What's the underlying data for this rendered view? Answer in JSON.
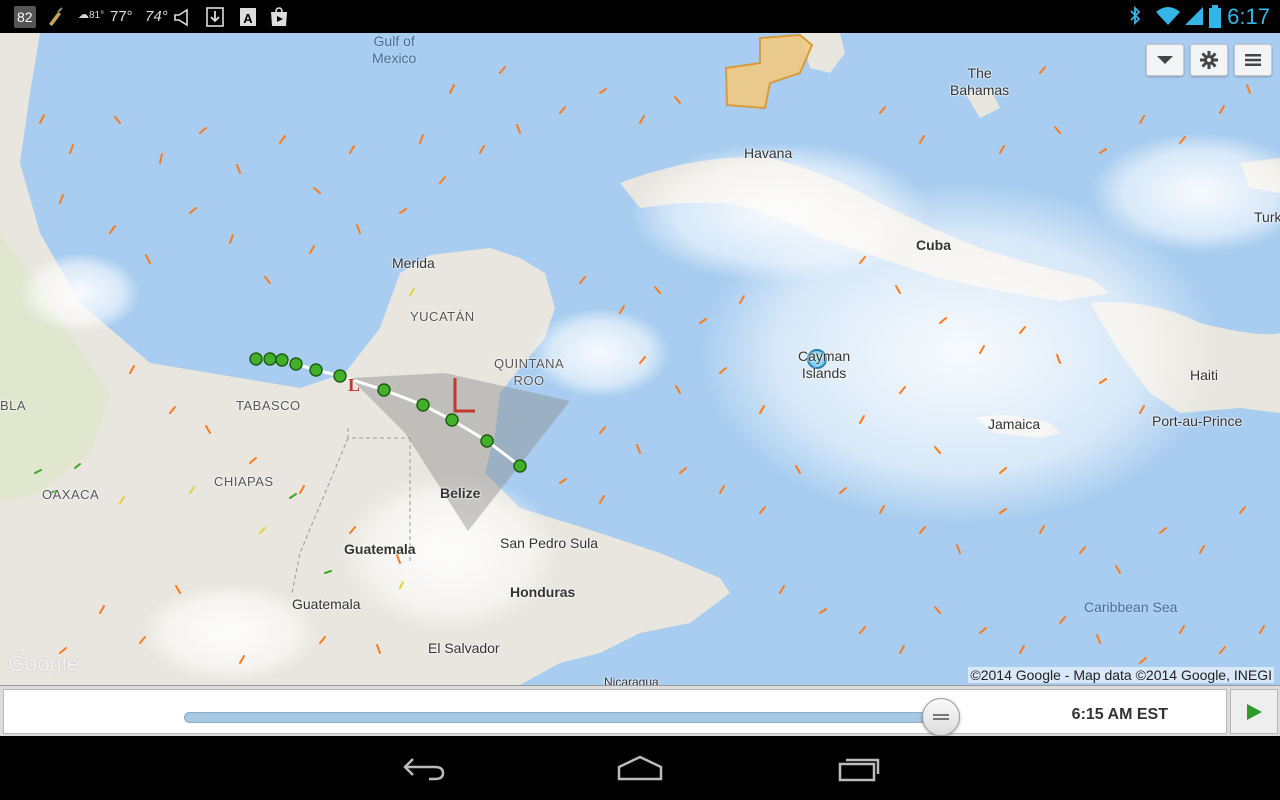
{
  "status_bar": {
    "temp_badge": "82",
    "weather_temp": "81°",
    "temp_77": "77°",
    "temp_74": "74°",
    "time": "6:17"
  },
  "map": {
    "labels": {
      "gulf_of_mexico": "Gulf of\nMexico",
      "the_bahamas": "The\nBahamas",
      "havana": "Havana",
      "cuba": "Cuba",
      "turks": "Turk",
      "merida": "Merida",
      "yucatan": "YUCATÁN",
      "quintana_roo": "QUINTANA\nROO",
      "cayman_islands": "Cayman\nIslands",
      "haiti": "Haiti",
      "port_au_prince": "Port-au-Prince",
      "jamaica": "Jamaica",
      "tabasco": "TABASCO",
      "chiapas": "CHIAPAS",
      "oaxaca": "OAXACA",
      "bla": "BLA",
      "belize": "Belize",
      "guatemala_country": "Guatemala",
      "guatemala_city": "Guatemala",
      "san_pedro_sula": "San Pedro Sula",
      "honduras": "Honduras",
      "el_salvador": "El Salvador",
      "caribbean_sea": "Caribbean Sea",
      "nicaragua": "Nicaragua"
    },
    "google_logo": "Google",
    "copyright": "©2014 Google - Map data ©2014 Google, INEGI",
    "storm_marker": "L"
  },
  "toolbar": {
    "dropdown_icon": "chevron-down-icon",
    "settings_icon": "gear-icon",
    "menu_icon": "menu-icon"
  },
  "timeline": {
    "time_label": "6:15 AM EST",
    "progress": 0.97
  },
  "nav": {
    "back": "back-icon",
    "home": "home-icon",
    "recents": "recents-icon"
  },
  "colors": {
    "ocean": "#a8cdf0",
    "land": "#e8e6df",
    "wind_arrow": "#ff7a1a",
    "track_point": "#43b02a",
    "status_accent": "#33b5e5",
    "cone": "#8f8f8f"
  }
}
